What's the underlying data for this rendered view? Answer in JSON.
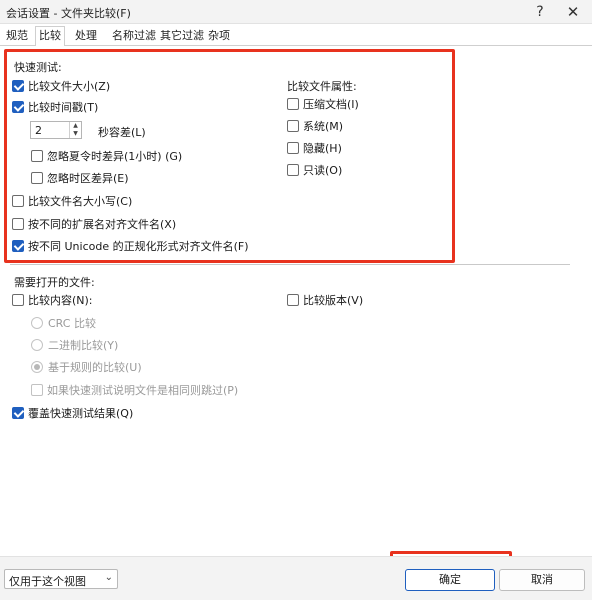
{
  "window": {
    "title": "会话设置 - 文件夹比较(F)",
    "help_glyph": "?",
    "close_glyph": "✕"
  },
  "tabs": [
    {
      "label": "规范"
    },
    {
      "label": "比较"
    },
    {
      "label": "处理"
    },
    {
      "label": "名称过滤"
    },
    {
      "label": "其它过滤"
    },
    {
      "label": "杂项"
    }
  ],
  "quick_test": {
    "heading": "快速测试:",
    "compare_size": {
      "label": "比较文件大小(Z)",
      "checked": true
    },
    "compare_timestamp": {
      "label": "比较时间戳(T)",
      "checked": true
    },
    "tolerance": {
      "value": "2",
      "label": "秒容差(L)"
    },
    "ignore_dst": {
      "label": "忽略夏令时差异(1小时) (G)",
      "checked": false
    },
    "ignore_timezone": {
      "label": "忽略时区差异(E)",
      "checked": false
    },
    "compare_name_case": {
      "label": "比较文件名大小写(C)",
      "checked": false
    },
    "align_by_ext": {
      "label": "按不同的扩展名对齐文件名(X)",
      "checked": false
    },
    "align_by_unicode": {
      "label": "按不同 Unicode 的正规化形式对齐文件名(F)",
      "checked": true
    }
  },
  "attributes": {
    "heading": "比较文件属性:",
    "archive": {
      "label": "压缩文档(I)",
      "checked": false
    },
    "system": {
      "label": "系统(M)",
      "checked": false
    },
    "hidden": {
      "label": "隐藏(H)",
      "checked": false
    },
    "readonly": {
      "label": "只读(O)",
      "checked": false
    }
  },
  "open_files": {
    "heading": "需要打开的文件:",
    "compare_content": {
      "label": "比较内容(N):",
      "checked": false
    },
    "compare_version": {
      "label": "比较版本(V)",
      "checked": false
    },
    "crc": {
      "label": "CRC 比较"
    },
    "binary": {
      "label": "二进制比较(Y)"
    },
    "rule_based": {
      "label": "基于规则的比较(U)",
      "selected": true
    },
    "skip_if_same": {
      "label": "如果快速测试说明文件是相同则跳过(P)",
      "checked": false
    },
    "override_quick": {
      "label": "覆盖快速测试结果(Q)",
      "checked": true
    }
  },
  "footer": {
    "scope": "仅用于这个视图",
    "ok": "确定",
    "cancel": "取消",
    "chevron_glyph": "⌄"
  },
  "colors": {
    "highlight": "#e8321e",
    "accent": "#1f5fbf"
  }
}
